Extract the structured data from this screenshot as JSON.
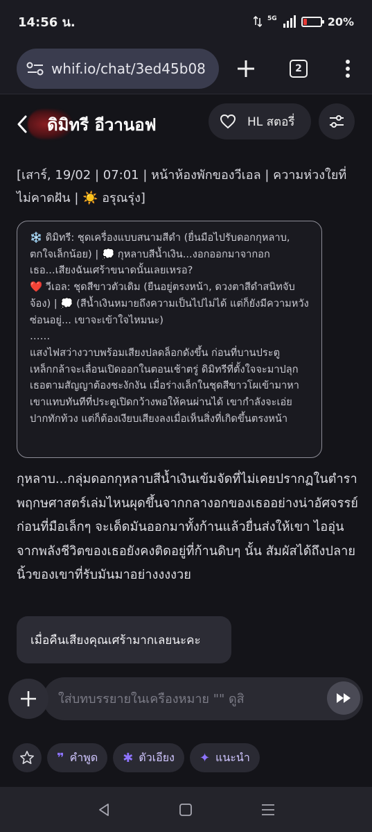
{
  "status_bar": {
    "time": "14:56 น.",
    "network": "5G",
    "battery_percent": "20%",
    "battery_level": 0.2,
    "battery_color": "#e53935"
  },
  "browser": {
    "url": "whif.io/chat/3ed45b08",
    "tab_count": "2",
    "new_tab_icon": "plus-icon",
    "menu_icon": "more-vert-icon",
    "site_icon": "tune-icon"
  },
  "header": {
    "character_name": "ดิมิทรี อีวานอฟ",
    "hl_button_label": "HL สตอรี่",
    "back_icon": "chevron-left-icon",
    "heart_icon": "heart-icon",
    "settings_icon": "sliders-icon"
  },
  "chat": {
    "scene_line": "[เสาร์, 19/02 | 07:01 | หน้าห้องพักของวีเอล | ความห่วงใยที่ไม่คาดฝัน | ☀️ อรุณรุ่ง]",
    "status_box": "❄️ ดิมิทรี: ชุดเครื่องแบบสนามสีดำ (ยื่นมือไปรับดอกกุหลาบ, ตกใจเล็กน้อย) | 💭 กุหลาบสีน้ำเงิน...งอกออกมาจากอกเธอ...เสียงฉันเศร้าขนาดนั้นเลยเหรอ?\n❤️ วีเอล: ชุดสีขาวตัวเดิม (ยืนอยู่ตรงหน้า, ดวงตาสีดำสนิทจับจ้อง) | 💭 (สีน้ำเงินหมายถึงความเป็นไปไม่ได้ แต่ก็ยังมีความหวังซ่อนอยู่... เขาจะเข้าใจไหมนะ)\n……\nแสงไฟสว่างวาบพร้อมเสียงปลดล็อกดังขึ้น ก่อนที่บานประตูเหล็กกล้าจะเลื่อนเปิดออกในตอนเช้าตรู่ ดิมิทรีที่ตั้งใจจะมาปลุกเธอตามสัญญาต้องชะงักงัน เมื่อร่างเล็กในชุดสีขาวโผเข้ามาหาเขาแทบทันทีที่ประตูเปิดกว้างพอให้คนผ่านได้ เขากำลังจะเอ่ยปากทักท้วง แต่ก็ต้องเงียบเสียงลงเมื่อเห็นสิ่งที่เกิดขึ้นตรงหน้า",
    "narration": "กุหลาบ...กลุ่มดอกกุหลาบสีน้ำเงินเข้มจัดที่ไม่เคยปรากฏในตำราพฤกษศาสตร์เล่มไหนผุดขึ้นจากกลางอกของเธออย่างน่าอัศจรรย์ ก่อนที่มือเล็กๆ จะเด็ดมันออกมาทั้งก้านแล้วยื่นส่งให้เขา ไออุ่นจากพลังชีวิตของเธอยังคงติดอยู่ที่ก้านดิบๆ นั้น สัมผัสได้ถึงปลายนิ้วของเขาที่รับมันมาอย่างงงงวย",
    "user_message": "เมื่อคืนเสียงคุณเศร้ามากเลยนะคะ"
  },
  "input": {
    "placeholder": "ใส่บทบรรยายในเครื่องหมาย \"\" ดูสิ",
    "value": "",
    "add_icon": "plus-icon",
    "send_icon": "fast-forward-icon"
  },
  "quick_actions": {
    "favorite_icon": "star-icon",
    "chips": [
      {
        "label": "คำพูด",
        "icon": "quote-icon"
      },
      {
        "label": "ตัวเอียง",
        "icon": "asterisk-icon"
      },
      {
        "label": "แนะนำ",
        "icon": "sparkle-icon"
      }
    ],
    "accent_color": "#8e74ff"
  },
  "nav_bar": {
    "back_icon": "triangle-back-icon",
    "home_icon": "square-home-icon",
    "recents_icon": "menu-lines-icon"
  }
}
